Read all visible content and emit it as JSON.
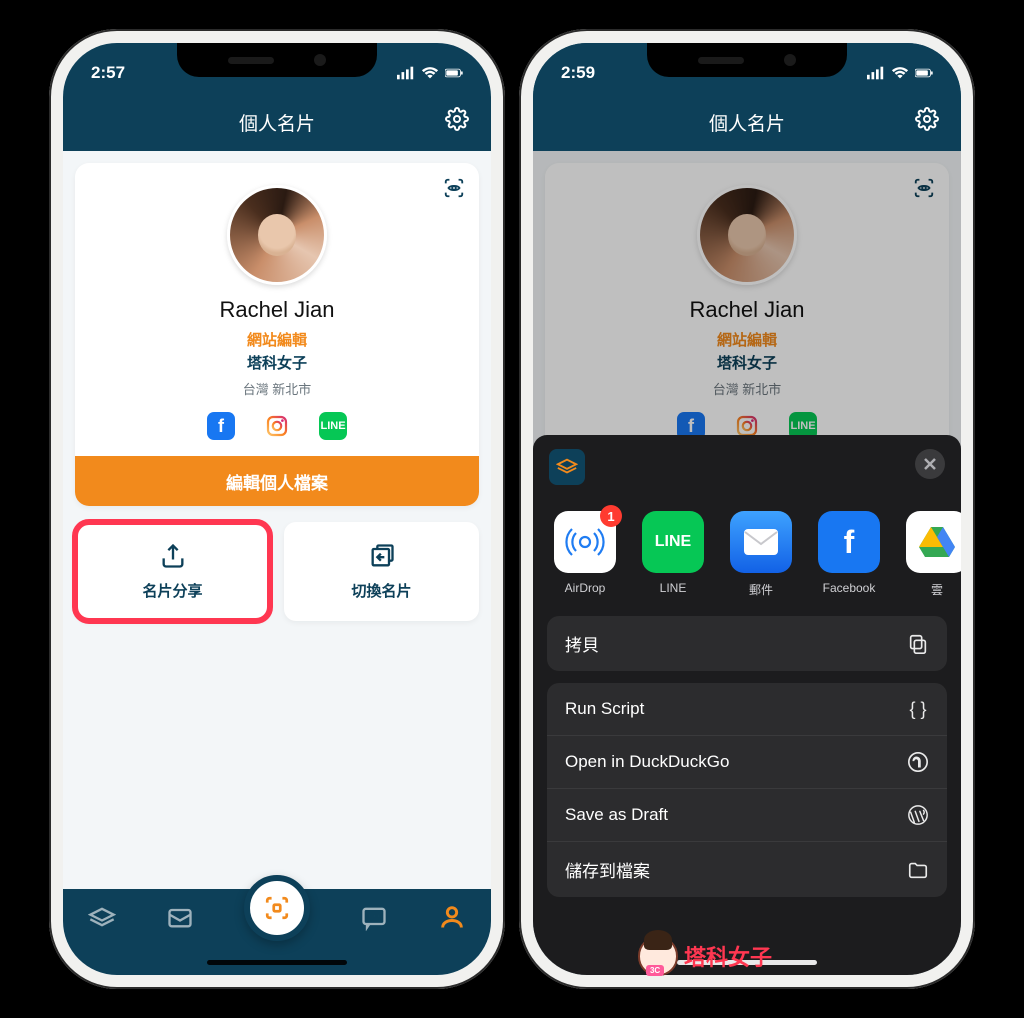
{
  "phone_left": {
    "statusbar": {
      "time": "2:57"
    },
    "header": {
      "title": "個人名片"
    },
    "profile": {
      "name": "Rachel Jian",
      "role": "網站編輯",
      "company": "塔科女子",
      "location": "台灣 新北市"
    },
    "edit_button": "編輯個人檔案",
    "action_cards": {
      "share": "名片分享",
      "switch": "切換名片"
    }
  },
  "phone_right": {
    "statusbar": {
      "time": "2:59"
    },
    "header": {
      "title": "個人名片"
    },
    "profile": {
      "name": "Rachel Jian",
      "role": "網站編輯",
      "company": "塔科女子",
      "location": "台灣 新北市"
    },
    "share_sheet": {
      "targets": [
        {
          "id": "airdrop",
          "label": "AirDrop",
          "badge": "1",
          "bg": "#ffffff"
        },
        {
          "id": "line",
          "label": "LINE",
          "bg": "#06c755"
        },
        {
          "id": "mail",
          "label": "郵件",
          "bg": "#1f7cf2"
        },
        {
          "id": "facebook",
          "label": "Facebook",
          "bg": "#1877f2"
        },
        {
          "id": "drive",
          "label": "雲",
          "bg": "#ffffff"
        }
      ],
      "actions_group1": [
        "拷貝"
      ],
      "actions_group2": [
        "Run Script",
        "Open in DuckDuckGo",
        "Save as Draft",
        "儲存到檔案"
      ]
    }
  },
  "watermark": "塔科女子",
  "colors": {
    "brand_navy": "#0d4059",
    "brand_orange": "#f28a1c",
    "highlight_red": "#ff3751"
  }
}
